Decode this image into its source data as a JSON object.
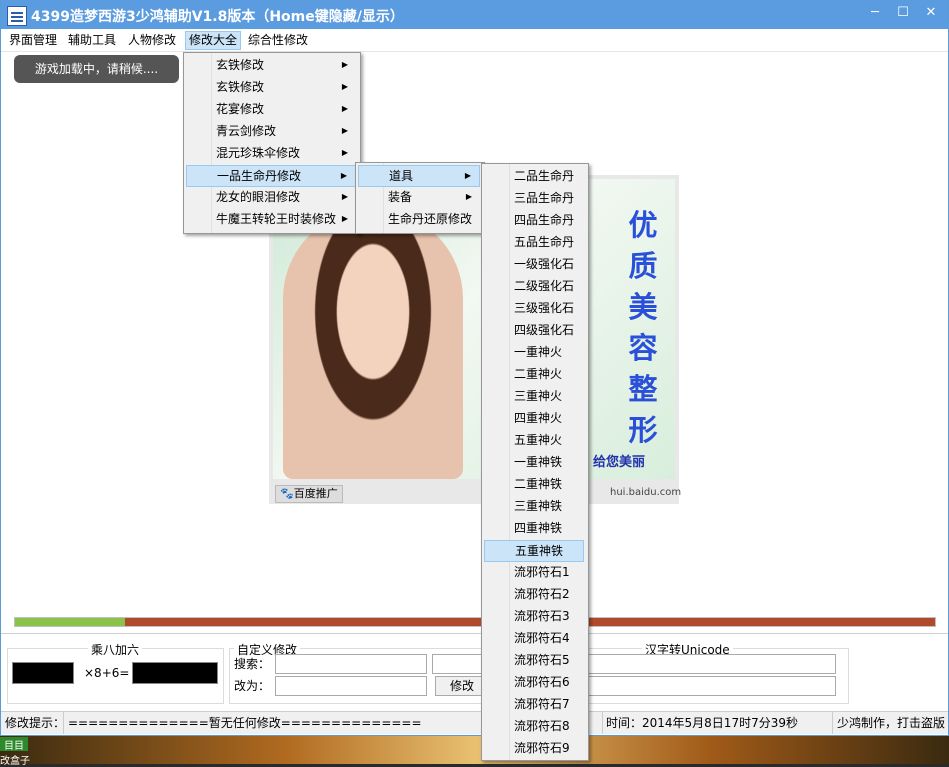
{
  "window": {
    "title": "4399造梦西游3少鸿辅助V1.8版本（Home键隐藏/显示）"
  },
  "menubar": [
    "界面管理",
    "辅助工具",
    "人物修改",
    "修改大全",
    "综合性修改"
  ],
  "loading_text": "游戏加载中，请稍候....",
  "ad": {
    "slogan": [
      "优",
      "质",
      "美",
      "容",
      "整",
      "形"
    ],
    "tagline": "给您美丽",
    "brand": "百度推广",
    "url": "hui.baidu.com"
  },
  "menu_level1": [
    "玄铁修改",
    "玄铁修改",
    "花宴修改",
    "青云剑修改",
    "混元珍珠伞修改",
    "一品生命丹修改",
    "龙女的眼泪修改",
    "牛魔王转轮王时装修改"
  ],
  "menu_level2": [
    "道具",
    "装备",
    "生命丹还原修改"
  ],
  "menu_level3": [
    "二品生命丹",
    "三品生命丹",
    "四品生命丹",
    "五品生命丹",
    "一级强化石",
    "二级强化石",
    "三级强化石",
    "四级强化石",
    "一重神火",
    "二重神火",
    "三重神火",
    "四重神火",
    "五重神火",
    "一重神铁",
    "二重神铁",
    "三重神铁",
    "四重神铁",
    "五重神铁",
    "流邪符石1",
    "流邪符石2",
    "流邪符石3",
    "流邪符石4",
    "流邪符石5",
    "流邪符石6",
    "流邪符石7",
    "流邪符石8",
    "流邪符石9"
  ],
  "progress": {
    "fraction": 0.12
  },
  "bottom": {
    "calc_title": "乘八加六",
    "calc_op": "×8+6=",
    "custom_title": "自定义修改",
    "search_label": "搜索：",
    "change_label": "改为：",
    "modify_button": "修改",
    "unicode_title": "汉字转Unicode"
  },
  "status": {
    "hint": "修改提示：",
    "message": "==============暂无任何修改==============",
    "time": "时间：2014年5月8日17时7分39秒",
    "author": "少鸿制作，打击盗版"
  },
  "desktop": {
    "icon_text": "目目",
    "label": "改盒子"
  },
  "colors": {
    "title_bar": "#5b9be0",
    "highlight": "#cce4f7",
    "progress_fill": "#8bc34a",
    "progress_rest": "#b04a2a",
    "slogan": "#2a4fd8"
  }
}
